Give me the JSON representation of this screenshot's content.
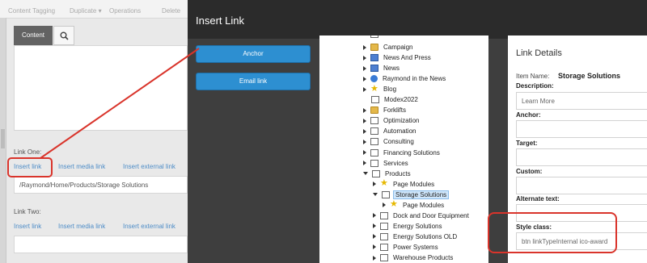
{
  "background": {
    "toolbar": [
      "Content Tagging",
      "Duplicate ▾",
      "Operations",
      "Delete"
    ],
    "tabs": {
      "content": "Content",
      "search_icon": "search-icon"
    },
    "link_one": {
      "label": "Link One:",
      "actions": [
        "Insert link",
        "Insert media link",
        "Insert external link"
      ],
      "value": "/Raymond/Home/Products/Storage Solutions"
    },
    "link_two": {
      "label": "Link Two:",
      "actions": [
        "Insert link",
        "Insert media link",
        "Insert external link"
      ],
      "value": ""
    }
  },
  "dialog": {
    "title": "Insert Link",
    "buttons": [
      "Anchor",
      "Email link"
    ],
    "tree": [
      {
        "label": "Campaign",
        "icon": "folder-icon",
        "expanded": false
      },
      {
        "label": "News And Press",
        "icon": "news-icon",
        "expanded": false
      },
      {
        "label": "News",
        "icon": "news-icon",
        "expanded": false
      },
      {
        "label": "Raymond in the News",
        "icon": "globe-icon",
        "expanded": false
      },
      {
        "label": "Blog",
        "icon": "star-icon",
        "expanded": false
      },
      {
        "label": "Modex2022",
        "icon": "page-icon",
        "expanded": null
      },
      {
        "label": "Forklifts",
        "icon": "folder-icon",
        "expanded": false
      },
      {
        "label": "Optimization",
        "icon": "page-icon",
        "expanded": false
      },
      {
        "label": "Automation",
        "icon": "page-icon",
        "expanded": false
      },
      {
        "label": "Consulting",
        "icon": "page-icon",
        "expanded": false
      },
      {
        "label": "Financing Solutions",
        "icon": "page-icon",
        "expanded": false
      },
      {
        "label": "Services",
        "icon": "page-icon",
        "expanded": false
      },
      {
        "label": "Products",
        "icon": "page-icon",
        "expanded": true
      },
      {
        "label": "Page Modules",
        "icon": "star-icon",
        "expanded": false
      },
      {
        "label": "Storage Solutions",
        "icon": "page-icon",
        "expanded": true,
        "selected": true
      },
      {
        "label": "Page Modules",
        "icon": "star-icon",
        "expanded": false
      },
      {
        "label": "Dock and Door Equipment",
        "icon": "page-icon",
        "expanded": false
      },
      {
        "label": "Energy Solutions",
        "icon": "page-icon",
        "expanded": false
      },
      {
        "label": "Energy Solutions OLD",
        "icon": "page-icon",
        "expanded": false
      },
      {
        "label": "Power Systems",
        "icon": "page-icon",
        "expanded": false
      },
      {
        "label": "Warehouse Products",
        "icon": "page-icon",
        "expanded": false
      }
    ],
    "details": {
      "title": "Link Details",
      "item_name_label": "Item Name:",
      "item_name_value": "Storage Solutions",
      "description_label": "Description:",
      "description_value": "Learn More",
      "anchor_label": "Anchor:",
      "anchor_value": "",
      "target_label": "Target:",
      "target_value": "",
      "custom_label": "Custom:",
      "custom_value": "",
      "alt_label": "Alternate text:",
      "alt_value": "",
      "style_label": "Style class:",
      "style_value": "btn linkTypeInternal ico-award"
    }
  },
  "colors": {
    "accent": "#2d8fd1",
    "highlight": "#d9342b",
    "link": "#4d8cc7"
  }
}
